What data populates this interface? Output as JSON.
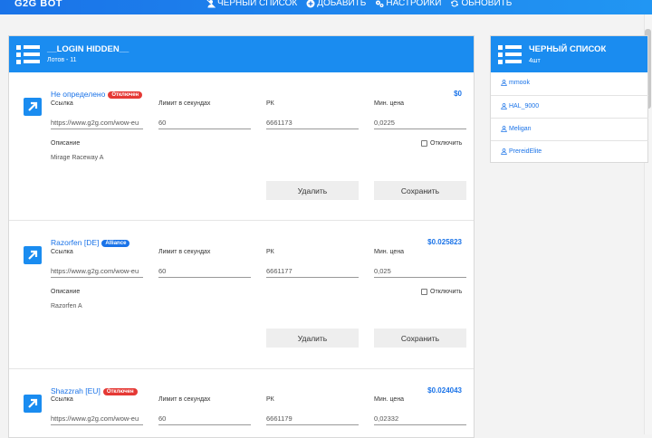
{
  "app": {
    "title": "G2G BOT"
  },
  "nav": {
    "blacklist": "ЧЕРНЫЙ СПИСОК",
    "add": "ДОБАВИТЬ",
    "settings": "НАСТРОЙКИ",
    "refresh": "ОБНОВИТЬ"
  },
  "lots_panel": {
    "title": "__LOGIN HIDDEN__",
    "subtitle": "Лотов - 11"
  },
  "labels": {
    "link": "Ссылка",
    "limit": "Лимит в секундах",
    "rk": "РК",
    "min_price": "Мин. цена",
    "description": "Описание",
    "disable": "Отключить",
    "delete": "Удалить",
    "save": "Сохранить"
  },
  "lots": [
    {
      "name": "Не определено",
      "badge": "Отключен",
      "badge_color": "#e53935",
      "price": "$0",
      "link": "https://www.g2g.com/wow-eu",
      "limit": "60",
      "rk": "6661173",
      "min_price": "0,0225",
      "description": "Mirage Raceway A"
    },
    {
      "name": "Razorfen [DE]",
      "badge": "Alliance",
      "badge_color": "#1a73e8",
      "price": "$0.025823",
      "link": "https://www.g2g.com/wow-eu",
      "limit": "60",
      "rk": "6661177",
      "min_price": "0,025",
      "description": "Razorfen A"
    },
    {
      "name": "Shazzrah [EU]",
      "badge": "Отключен",
      "badge_color": "#e53935",
      "price": "$0.024043",
      "link": "https://www.g2g.com/wow-eu",
      "limit": "60",
      "rk": "6661179",
      "min_price": "0,02332",
      "description": ""
    }
  ],
  "blacklist_panel": {
    "title": "ЧЕРНЫЙ СПИСОК",
    "subtitle": "4шт",
    "items": [
      "mmook",
      "HAL_9000",
      "Meligan",
      "PrereidElite"
    ]
  },
  "colors": {
    "accent": "#1a8cf0",
    "badge_red": "#e53935",
    "badge_blue": "#1a73e8"
  }
}
